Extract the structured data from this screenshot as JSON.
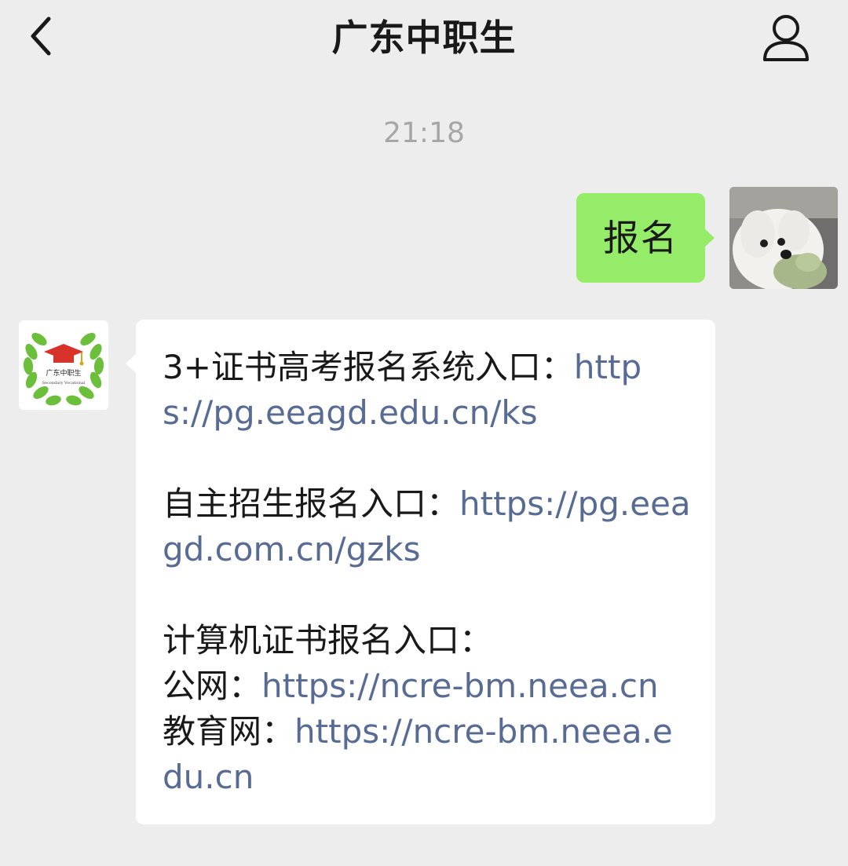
{
  "header": {
    "title": "广东中职生",
    "back_icon": "chevron-left-icon",
    "profile_icon": "person-icon"
  },
  "timestamp": "21:18",
  "messages": {
    "outgoing": {
      "text": "报名",
      "bubble_color": "#95ec69"
    },
    "incoming": {
      "bubble_color": "#ffffff",
      "link_color": "#576b95",
      "section1": {
        "label": "3+证书高考报名系统入口：",
        "url": "https://pg.eeagd.edu.cn/ks"
      },
      "section2": {
        "label": "自主招生报名入口：",
        "url": "https://pg.eeagd.com.cn/gzks"
      },
      "section3": {
        "heading": "计算机证书报名入口：",
        "public_label": "公网：",
        "public_url": "https://ncre-bm.neea.cn",
        "edu_label": "教育网：",
        "edu_url": "https://ncre-bm.neea.edu.cn"
      }
    }
  },
  "account_avatar": {
    "logo_text": "广东中职生",
    "logo_subtext": "Secondary Vocational"
  },
  "colors": {
    "background": "#ededed",
    "timestamp": "#a6a6a6"
  }
}
